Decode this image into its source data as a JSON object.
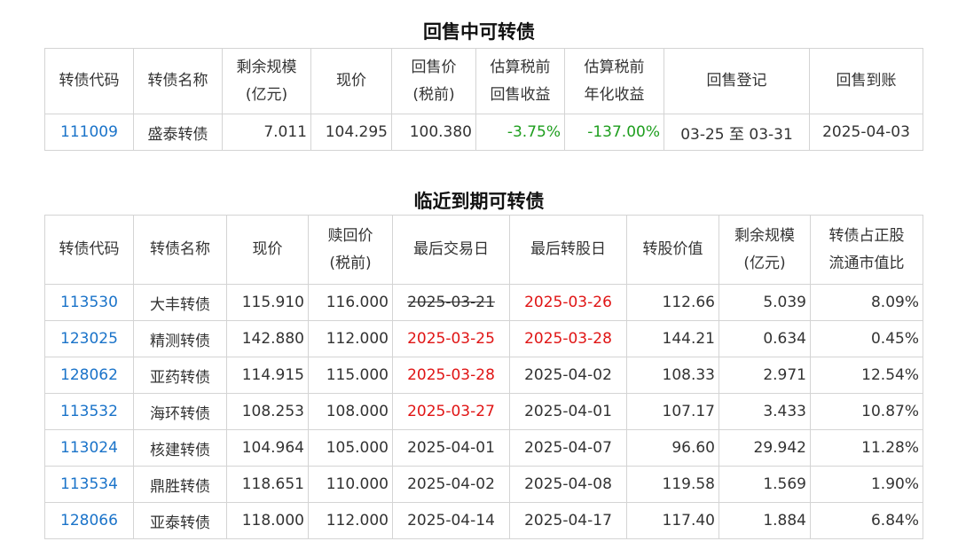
{
  "put_section": {
    "title": "回售中可转债",
    "headers": [
      [
        "转债代码"
      ],
      [
        "转债名称"
      ],
      [
        "剩余规模",
        "(亿元)"
      ],
      [
        "现价"
      ],
      [
        "回售价",
        "(税前)"
      ],
      [
        "估算税前",
        "回售收益"
      ],
      [
        "估算税前",
        "年化收益"
      ],
      [
        "回售登记"
      ],
      [
        "回售到账"
      ]
    ],
    "rows": [
      {
        "code": "111009",
        "name": "盛泰转债",
        "remaining": "7.011",
        "price": "104.295",
        "put_price": "100.380",
        "put_yield": "-3.75%",
        "annual_yield": "-137.00%",
        "registration": "03-25 至 03-31",
        "payment": "2025-04-03"
      }
    ]
  },
  "maturity_section": {
    "title": "临近到期可转债",
    "headers": [
      [
        "转债代码"
      ],
      [
        "转债名称"
      ],
      [
        "现价"
      ],
      [
        "赎回价",
        "(税前)"
      ],
      [
        "最后交易日"
      ],
      [
        "最后转股日"
      ],
      [
        "转股价值"
      ],
      [
        "剩余规模",
        "(亿元)"
      ],
      [
        "转债占正股",
        "流通市值比"
      ]
    ],
    "rows": [
      {
        "code": "113530",
        "name": "大丰转债",
        "price": "115.910",
        "redeem": "116.000",
        "last_trade": "2025-03-21",
        "last_trade_style": "strike",
        "last_convert": "2025-03-26",
        "last_convert_style": "red",
        "conv_value": "112.66",
        "remaining": "5.039",
        "ratio": "8.09%"
      },
      {
        "code": "123025",
        "name": "精测转债",
        "price": "142.880",
        "redeem": "112.000",
        "last_trade": "2025-03-25",
        "last_trade_style": "red",
        "last_convert": "2025-03-28",
        "last_convert_style": "red",
        "conv_value": "144.21",
        "remaining": "0.634",
        "ratio": "0.45%"
      },
      {
        "code": "128062",
        "name": "亚药转债",
        "price": "114.915",
        "redeem": "115.000",
        "last_trade": "2025-03-28",
        "last_trade_style": "red",
        "last_convert": "2025-04-02",
        "last_convert_style": "normal",
        "conv_value": "108.33",
        "remaining": "2.971",
        "ratio": "12.54%"
      },
      {
        "code": "113532",
        "name": "海环转债",
        "price": "108.253",
        "redeem": "108.000",
        "last_trade": "2025-03-27",
        "last_trade_style": "red",
        "last_convert": "2025-04-01",
        "last_convert_style": "normal",
        "conv_value": "107.17",
        "remaining": "3.433",
        "ratio": "10.87%"
      },
      {
        "code": "113024",
        "name": "核建转债",
        "price": "104.964",
        "redeem": "105.000",
        "last_trade": "2025-04-01",
        "last_trade_style": "normal",
        "last_convert": "2025-04-07",
        "last_convert_style": "normal",
        "conv_value": "96.60",
        "remaining": "29.942",
        "ratio": "11.28%"
      },
      {
        "code": "113534",
        "name": "鼎胜转债",
        "price": "118.651",
        "redeem": "110.000",
        "last_trade": "2025-04-02",
        "last_trade_style": "normal",
        "last_convert": "2025-04-08",
        "last_convert_style": "normal",
        "conv_value": "119.58",
        "remaining": "1.569",
        "ratio": "1.90%"
      },
      {
        "code": "128066",
        "name": "亚泰转债",
        "price": "118.000",
        "redeem": "112.000",
        "last_trade": "2025-04-14",
        "last_trade_style": "normal",
        "last_convert": "2025-04-17",
        "last_convert_style": "normal",
        "conv_value": "117.40",
        "remaining": "1.884",
        "ratio": "6.84%"
      }
    ]
  },
  "colors": {
    "code_link": "#1a73c9",
    "negative": "#1e9e1e",
    "highlight_date": "#e01515",
    "border": "#d4d4d4"
  }
}
